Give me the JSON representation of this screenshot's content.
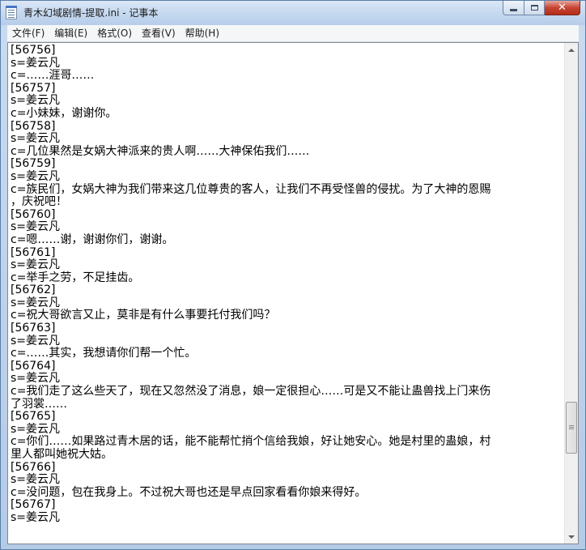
{
  "window": {
    "title": "青木幻域剧情-提取.ini - 记事本",
    "colors": {
      "title_gradient_top": "#dbe8f7",
      "title_gradient_bottom": "#b7cde9",
      "close_button": "#c74433"
    }
  },
  "menubar": {
    "items": [
      "文件(F)",
      "编辑(E)",
      "格式(O)",
      "查看(V)",
      "帮助(H)"
    ]
  },
  "document": {
    "lines": [
      "[56756]",
      "s=姜云凡",
      "c=……涯哥……",
      "[56757]",
      "s=姜云凡",
      "c=小妹妹，谢谢你。",
      "[56758]",
      "s=姜云凡",
      "c=几位果然是女娲大神派来的贵人啊……大神保佑我们……",
      "[56759]",
      "s=姜云凡",
      "c=族民们，女娲大神为我们带来这几位尊贵的客人，让我们不再受怪兽的侵扰。为了大神的恩赐",
      "，庆祝吧！",
      "[56760]",
      "s=姜云凡",
      "c=嗯……谢，谢谢你们，谢谢。",
      "[56761]",
      "s=姜云凡",
      "c=举手之劳，不足挂齿。",
      "[56762]",
      "s=姜云凡",
      "c=祝大哥欲言又止，莫非是有什么事要托付我们吗？",
      "[56763]",
      "s=姜云凡",
      "c=……其实，我想请你们帮一个忙。",
      "[56764]",
      "s=姜云凡",
      "c=我们走了这么些天了，现在又忽然没了消息，娘一定很担心……可是又不能让蛊兽找上门来伤",
      "了羽裳……",
      "[56765]",
      "s=姜云凡",
      "c=你们……如果路过青木居的话，能不能帮忙捎个信给我娘，好让她安心。她是村里的蛊娘，村",
      "里人都叫她祝大姑。",
      "[56766]",
      "s=姜云凡",
      "c=没问题，包在我身上。不过祝大哥也还是早点回家看看你娘来得好。",
      "[56767]",
      "s=姜云凡"
    ]
  },
  "scrollbar": {
    "position_fraction": 0.82
  }
}
